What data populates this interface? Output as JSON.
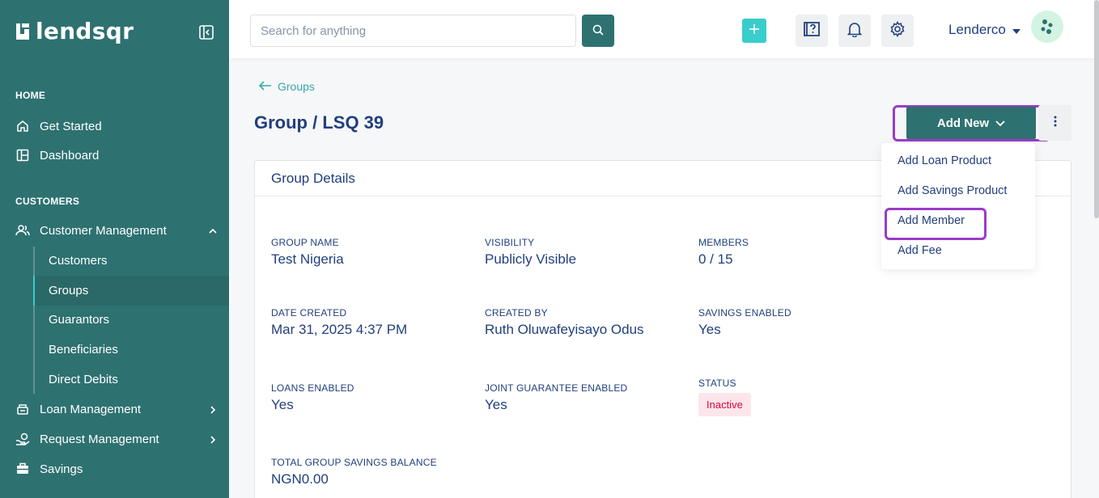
{
  "brand": {
    "name": "lendsqr"
  },
  "sidebar": {
    "sections": {
      "home": "HOME",
      "customers": "CUSTOMERS"
    },
    "items": {
      "get_started": "Get Started",
      "dashboard": "Dashboard",
      "customer_management": "Customer Management",
      "loan_management": "Loan Management",
      "request_management": "Request Management",
      "savings": "Savings"
    },
    "sub_items": [
      "Customers",
      "Groups",
      "Guarantors",
      "Beneficiaries",
      "Direct Debits"
    ],
    "active_sub_item": "Groups"
  },
  "topbar": {
    "search_placeholder": "Search for anything",
    "user_name": "Lenderco"
  },
  "main": {
    "back_label": "Groups",
    "title": "Group / LSQ 39",
    "add_new_label": "Add New",
    "dropdown": [
      "Add Loan Product",
      "Add Savings Product",
      "Add Member",
      "Add Fee"
    ],
    "card_title": "Group Details",
    "fields": [
      {
        "label": "GROUP NAME",
        "value": "Test Nigeria"
      },
      {
        "label": "VISIBILITY",
        "value": "Publicly Visible"
      },
      {
        "label": "MEMBERS",
        "value": "0 / 15"
      },
      {
        "label": "DATE CREATED",
        "value": "Mar 31, 2025 4:37 PM"
      },
      {
        "label": "CREATED BY",
        "value": "Ruth Oluwafeyisayo Odus"
      },
      {
        "label": "SAVINGS ENABLED",
        "value": "Yes"
      },
      {
        "label": "LOANS ENABLED",
        "value": "Yes"
      },
      {
        "label": "JOINT GUARANTEE ENABLED",
        "value": "Yes"
      },
      {
        "label": "STATUS",
        "value": "Inactive"
      },
      {
        "label": "TOTAL GROUP SAVINGS BALANCE",
        "value": "NGN0.00"
      }
    ]
  },
  "colors": {
    "sidebar": "#2e7171",
    "accent": "#39cdcc",
    "text": "#213f7d",
    "highlight": "#9b3bc9",
    "status_inactive": "#e4033b"
  }
}
